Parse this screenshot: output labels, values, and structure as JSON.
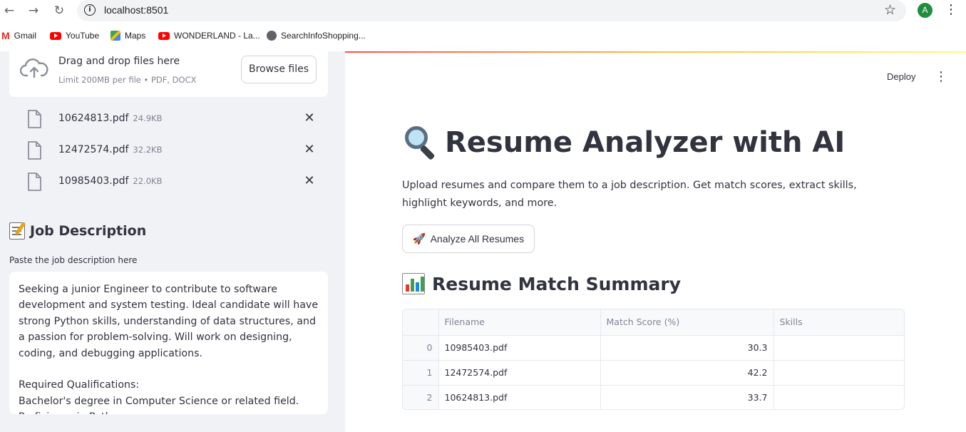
{
  "browser": {
    "url": "localhost:8501",
    "profile_initial": "A",
    "bookmarks": [
      {
        "label": "Gmail",
        "icon": "gmail-icon"
      },
      {
        "label": "YouTube",
        "icon": "youtube-icon"
      },
      {
        "label": "Maps",
        "icon": "maps-icon"
      },
      {
        "label": "WONDERLAND - La...",
        "icon": "youtube-icon"
      },
      {
        "label": "SearchInfoShopping...",
        "icon": "globe-icon"
      }
    ]
  },
  "sidebar": {
    "uploader": {
      "title": "Drag and drop files here",
      "limit": "Limit 200MB per file • PDF, DOCX",
      "browse_label": "Browse files"
    },
    "files": [
      {
        "name": "10624813.pdf",
        "size": "24.9KB"
      },
      {
        "name": "12472574.pdf",
        "size": "32.2KB"
      },
      {
        "name": "10985403.pdf",
        "size": "22.0KB"
      }
    ],
    "job_heading": "Job Description",
    "job_label": "Paste the job description here",
    "job_text": "Seeking a junior Engineer to contribute to software development and system testing. Ideal candidate will have strong Python skills, understanding of data structures, and a passion for problem-solving. Will work on designing, coding, and debugging applications.\n\nRequired Qualifications:\nBachelor's degree in Computer Science or related field.\nProficiency in Python"
  },
  "header": {
    "deploy_label": "Deploy"
  },
  "main": {
    "title": "Resume Analyzer with AI",
    "subtitle": "Upload resumes and compare them to a job description. Get match scores, extract skills, highlight keywords, and more.",
    "analyze_label": "Analyze All Resumes",
    "summary_heading": "Resume Match Summary",
    "table": {
      "columns": [
        "",
        "Filename",
        "Match Score (%)",
        "Skills"
      ],
      "rows": [
        {
          "index": "0",
          "filename": "10985403.pdf",
          "score": "30.3",
          "skills": ""
        },
        {
          "index": "1",
          "filename": "12472574.pdf",
          "score": "42.2",
          "skills": ""
        },
        {
          "index": "2",
          "filename": "10624813.pdf",
          "score": "33.7",
          "skills": ""
        }
      ]
    }
  },
  "colors": {
    "accent_gradient": [
      "#ff4b4b",
      "#ffbd45",
      "#fffd80"
    ],
    "sidebar_bg": "#f0f2f6",
    "text": "#31333f"
  }
}
